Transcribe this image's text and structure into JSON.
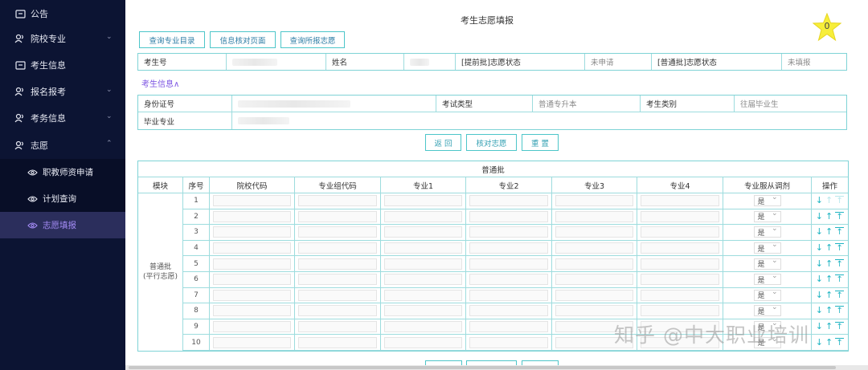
{
  "sidebar": {
    "items": [
      {
        "label": "公告",
        "icon": "notice-icon"
      },
      {
        "label": "院校专业",
        "icon": "people-icon",
        "expand": "chevron-down"
      },
      {
        "label": "考生信息",
        "icon": "id-card-icon"
      },
      {
        "label": "报名报考",
        "icon": "people-icon",
        "expand": "chevron-down"
      },
      {
        "label": "考务信息",
        "icon": "people-icon",
        "expand": "chevron-down"
      },
      {
        "label": "志愿",
        "icon": "people-icon",
        "expand": "chevron-up"
      }
    ],
    "subitems": [
      {
        "label": "职教师资申请",
        "icon": "eye-icon"
      },
      {
        "label": "计划查询",
        "icon": "eye-icon"
      },
      {
        "label": "志愿填报",
        "icon": "eye-icon",
        "active": true
      }
    ]
  },
  "page": {
    "title": "考生志愿填报",
    "badge_count": "0",
    "top_buttons": [
      "查询专业目录",
      "信息核对页面",
      "查询所报志愿"
    ]
  },
  "student_row": {
    "exam_no_label": "考生号",
    "name_label": "姓名",
    "early_status_label": "[提前批]志愿状态",
    "early_status_value": "未申请",
    "normal_status_label": "[普通批]志愿状态",
    "normal_status_value": "未填报"
  },
  "info_toggle": "考生信息∧",
  "info": {
    "id_label": "身份证号",
    "exam_type_label": "考试类型",
    "exam_type_value": "普通专升本",
    "category_label": "考生类别",
    "category_value": "往届毕业生",
    "major_label": "毕业专业"
  },
  "action_buttons": [
    "返 回",
    "核对志愿",
    "重 置"
  ],
  "grid": {
    "title": "普通批",
    "headers": [
      "模块",
      "序号",
      "院校代码",
      "专业组代码",
      "专业1",
      "专业2",
      "专业3",
      "专业4",
      "专业服从调剂",
      "操作"
    ],
    "module_label_line1": "普通批",
    "module_label_line2": "(平行志愿)",
    "rows": [
      "1",
      "2",
      "3",
      "4",
      "5",
      "6",
      "7",
      "8",
      "9",
      "10"
    ],
    "adjust_default": "是"
  },
  "watermark": "知乎 @中大职业培训"
}
